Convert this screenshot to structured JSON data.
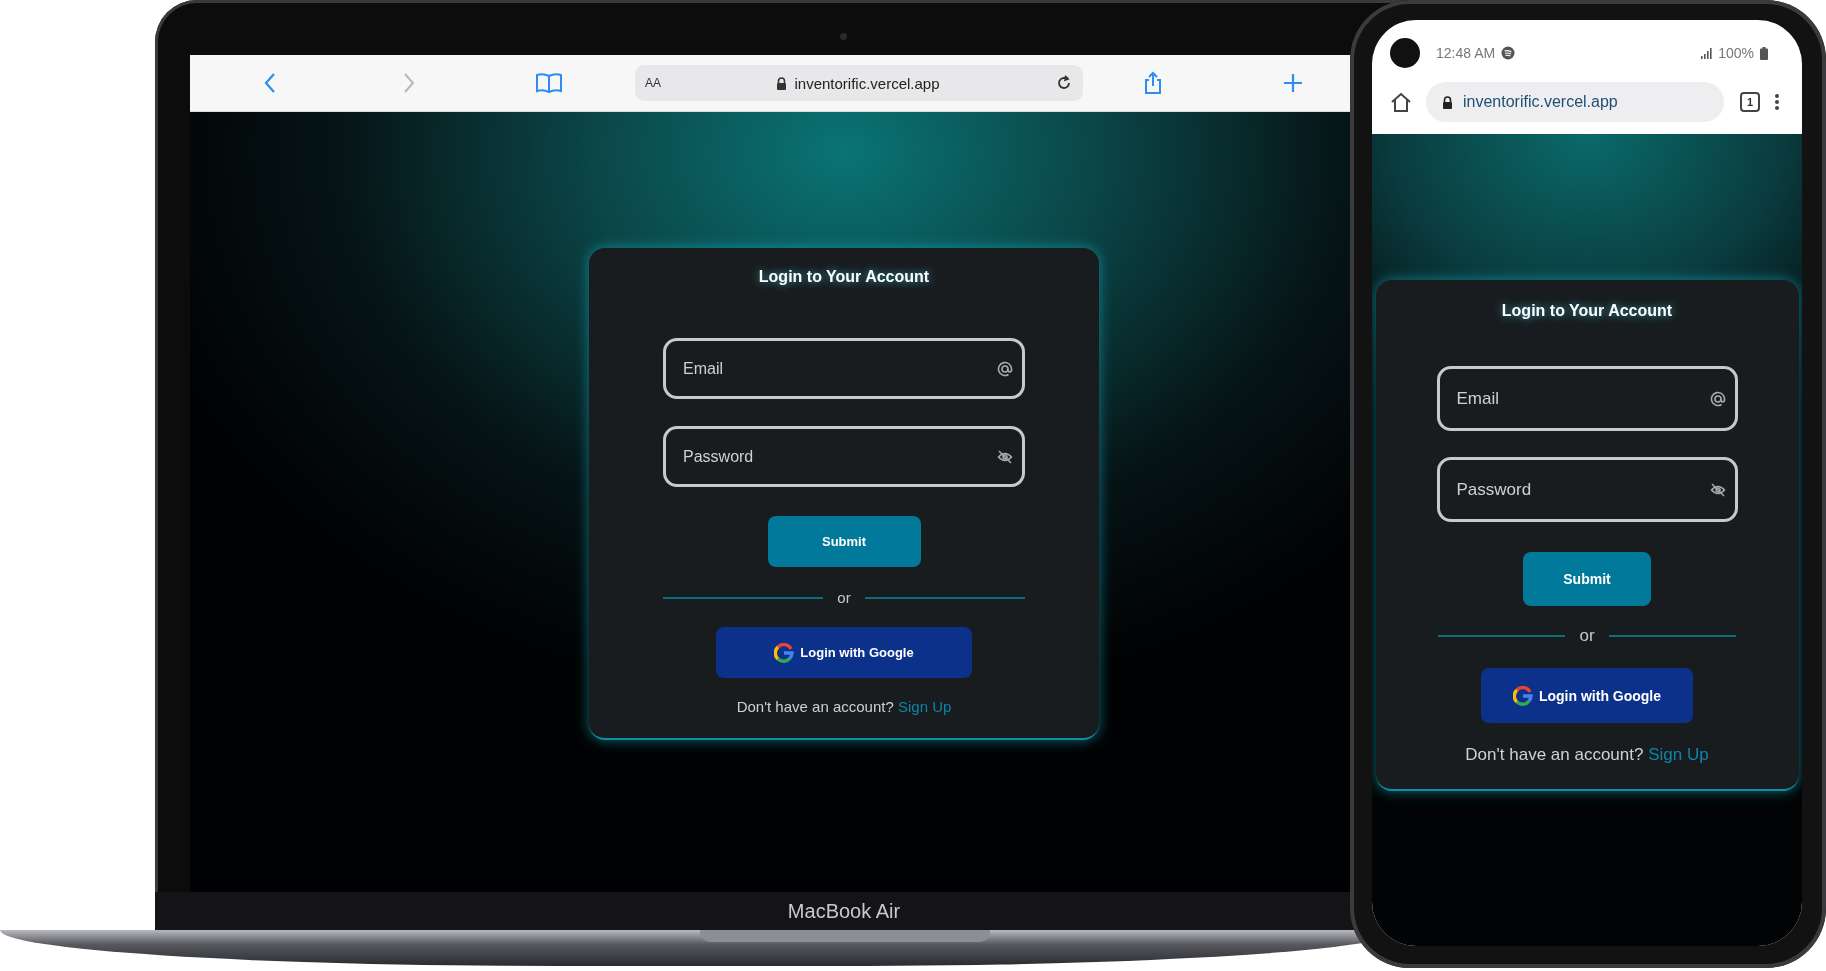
{
  "laptop": {
    "browser": {
      "text_size_button": "AA",
      "address": "inventorific.vercel.app"
    },
    "login": {
      "title": "Login to Your Account",
      "fields": [
        {
          "kind": "email",
          "placeholder": "Email"
        },
        {
          "kind": "password",
          "placeholder": "Password"
        }
      ],
      "submit": "Submit",
      "divider": "or",
      "google_button": "Login with Google",
      "signup_prompt": "Don't have an account?",
      "signup_link": "Sign Up"
    },
    "label": "MacBook Air"
  },
  "phone": {
    "status_bar": {
      "time": "12:48 AM",
      "battery": "100%"
    },
    "browser": {
      "address": "inventorific.vercel.app",
      "tab_count": "1"
    },
    "login": {
      "title": "Login to Your Account",
      "fields": [
        {
          "kind": "email",
          "placeholder": "Email"
        },
        {
          "kind": "password",
          "placeholder": "Password"
        }
      ],
      "submit": "Submit",
      "divider": "or",
      "google_button": "Login with Google",
      "signup_prompt": "Don't have an account?",
      "signup_link": "Sign Up"
    }
  }
}
